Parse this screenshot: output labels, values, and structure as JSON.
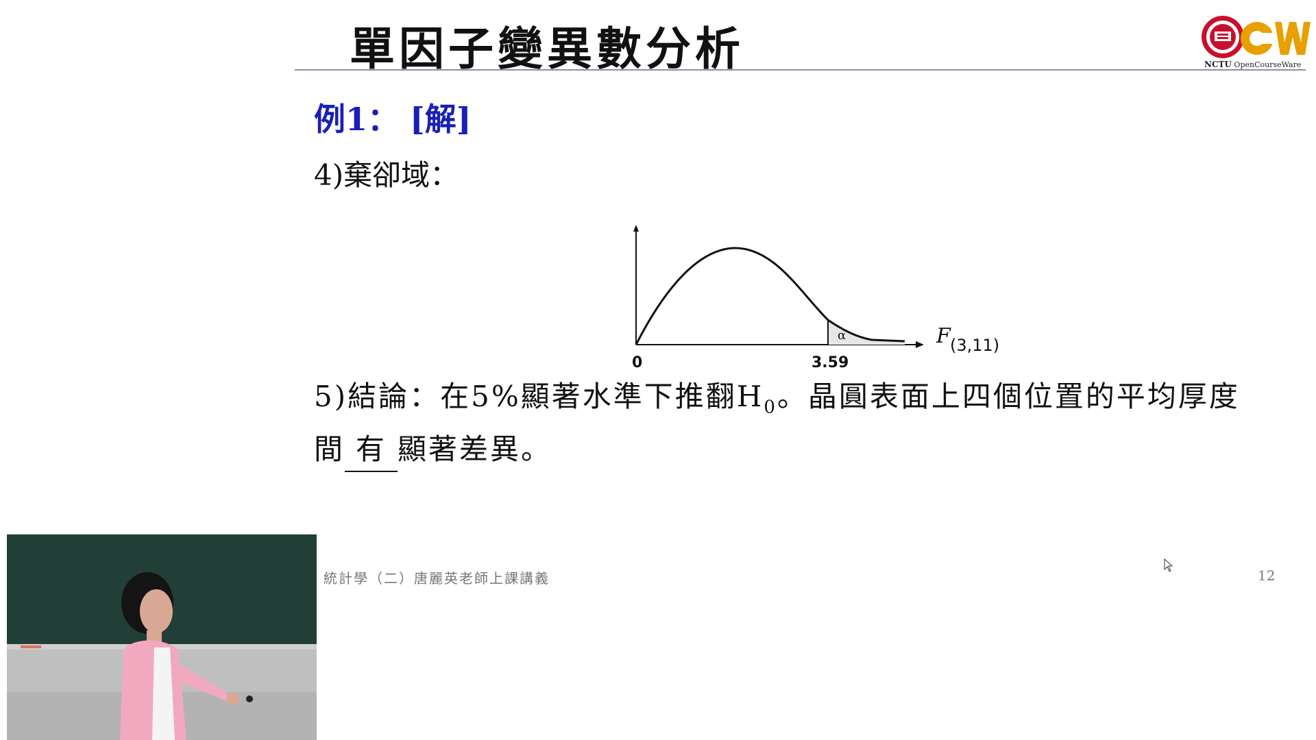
{
  "slide": {
    "title": "單因子變異數分析",
    "example_heading": "例1： [解]",
    "step4": "4)棄卻域：",
    "step5_part1": "5)結論：在5%顯著水準下推翻H",
    "step5_subscript": "0",
    "step5_part2": "。晶圓表面上四個位置的平均厚度間",
    "step5_blank": "有",
    "step5_part3": "顯著差異。",
    "footer": "統計學（二）唐麗英老師上課講義",
    "page_number": "12"
  },
  "logo": {
    "name": "NCTU",
    "tagline": "OpenCourseWare",
    "colors": {
      "seal": "#c8102e",
      "ocw": "#e8a000"
    }
  },
  "chart_data": {
    "type": "line",
    "x_axis_label_main": "F",
    "x_axis_label_sub": "(3,11)",
    "tick_labels": [
      "0",
      "3.59"
    ],
    "region_label": "α",
    "description_values": {
      "critical_value": 3.59
    }
  },
  "colors": {
    "heading_blue": "#1a1fb8",
    "text": "#111111",
    "footer": "#777777",
    "rule": "#8a8fa8"
  }
}
